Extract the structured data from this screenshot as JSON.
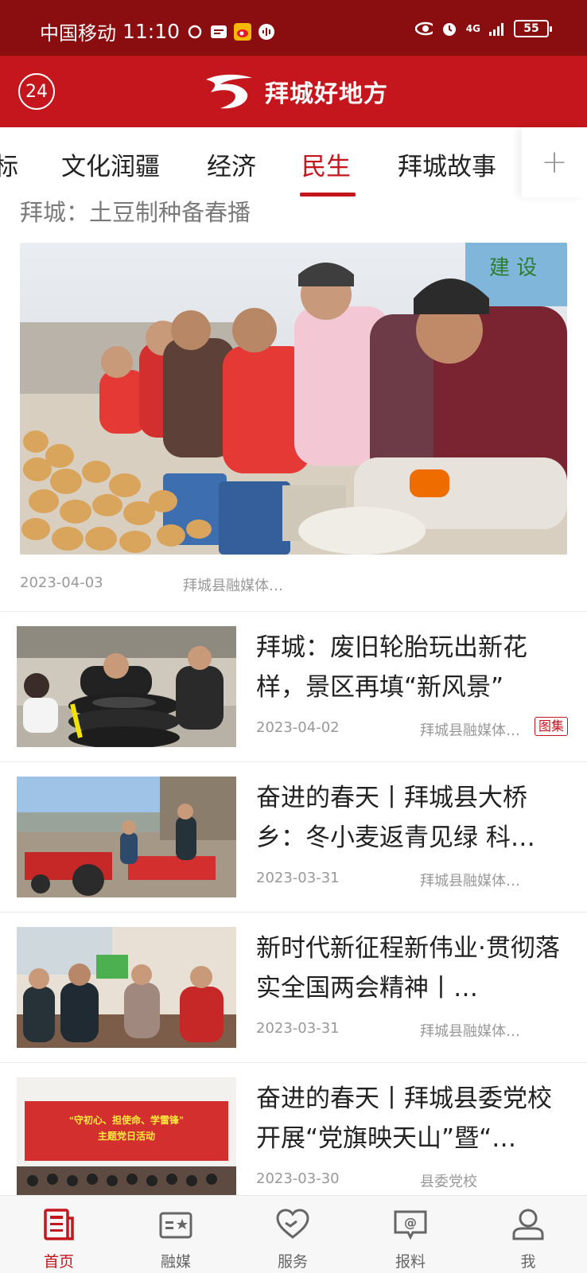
{
  "status_bar": {
    "carrier": "中国移动",
    "time": "11:10",
    "network": "4G",
    "battery": "55"
  },
  "header": {
    "badge": "24",
    "app_title": "拜城好地方"
  },
  "tabs": [
    {
      "label": "标"
    },
    {
      "label": "文化润疆"
    },
    {
      "label": "经济"
    },
    {
      "label": "民生"
    },
    {
      "label": "拜城故事"
    }
  ],
  "active_tab": "民生",
  "add_tab": "+",
  "featured": {
    "title": "拜城：土豆制种备春播",
    "date": "2023-04-03",
    "source": "拜城县融媒体…",
    "watermark": "建 设"
  },
  "news": [
    {
      "title": "拜城：废旧轮胎玩出新花样，景区再填“新风景”",
      "date": "2023-04-02",
      "source": "拜城县融媒体…",
      "tag": "图集"
    },
    {
      "title": "奋进的春天丨拜城县大桥乡：冬小麦返青见绿 科…",
      "date": "2023-03-31",
      "source": "拜城县融媒体…"
    },
    {
      "title": "新时代新征程新伟业·贯彻落实全国两会精神丨…",
      "date": "2023-03-31",
      "source": "拜城县融媒体…"
    },
    {
      "title": "奋进的春天丨拜城县委党校开展“党旗映天山”暨“…",
      "date": "2023-03-30",
      "source": "县委党校",
      "banner_line1": "“守初心、担使命、学雷锋”",
      "banner_line2": "主题党日活动"
    }
  ],
  "bottom_nav": [
    {
      "label": "首页",
      "icon": "news-icon"
    },
    {
      "label": "融媒",
      "icon": "media-icon"
    },
    {
      "label": "服务",
      "icon": "heart-hands-icon"
    },
    {
      "label": "报料",
      "icon": "report-at-icon"
    },
    {
      "label": "我",
      "icon": "user-icon"
    }
  ],
  "colors": {
    "brand_red": "#c4161c",
    "status_bar": "#8a0d0f"
  }
}
